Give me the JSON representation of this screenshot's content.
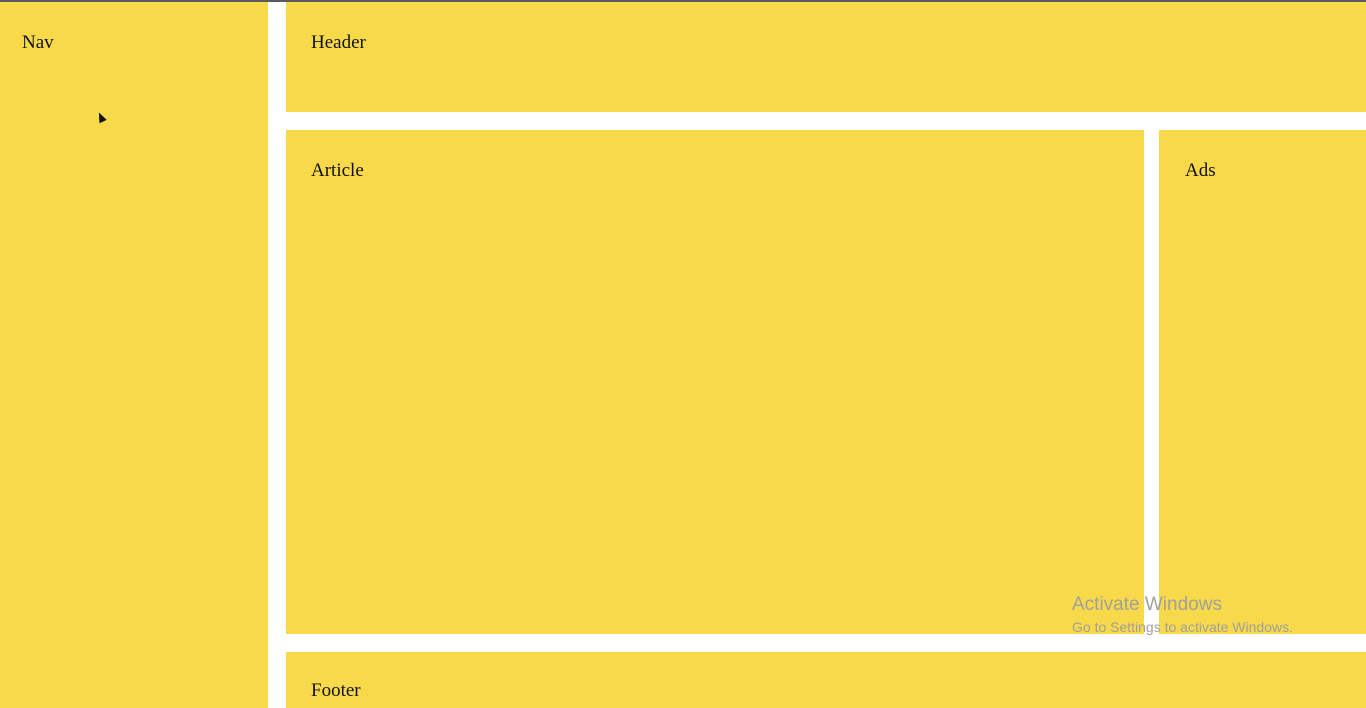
{
  "layout": {
    "nav_label": "Nav",
    "header_label": "Header",
    "article_label": "Article",
    "ads_label": "Ads",
    "footer_label": "Footer"
  },
  "watermark": {
    "title": "Activate Windows",
    "subtitle": "Go to Settings to activate Windows."
  },
  "colors": {
    "panel": "#f7d94a",
    "gap": "#ffffff",
    "text": "#111111",
    "watermark": "#a0a0a0"
  }
}
